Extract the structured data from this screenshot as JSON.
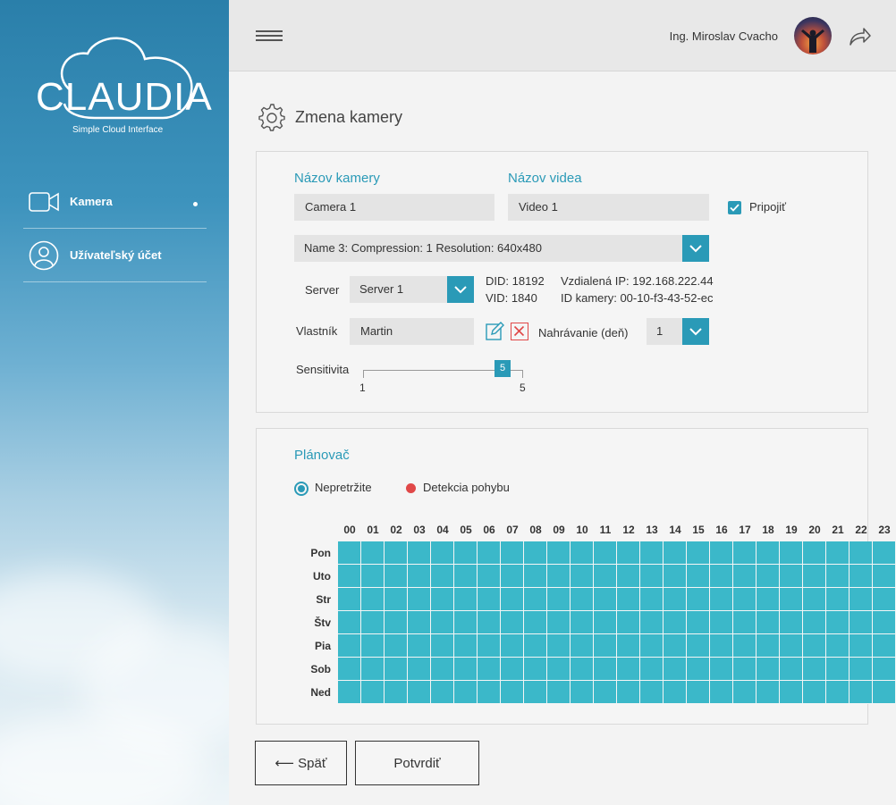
{
  "brand": {
    "logo_text": "CLAUDIA",
    "tagline": "Simple Cloud Interface"
  },
  "sidebar": {
    "items": [
      {
        "label": "Kamera",
        "icon": "video-camera-icon",
        "active": true
      },
      {
        "label": "Užívateľský účet",
        "icon": "user-icon",
        "active": false
      }
    ]
  },
  "header": {
    "user_name": "Ing. Miroslav Cvacho"
  },
  "page": {
    "title": "Zmena kamery"
  },
  "form": {
    "camera_name_label": "Názov kamery",
    "camera_name_value": "Camera 1",
    "video_name_label": "Názov videa",
    "video_name_value": "Video 1",
    "connect_label": "Pripojiť",
    "connect_checked": true,
    "stream_select": "Name 3: Compression: 1 Resolution: 640x480",
    "server_label": "Server",
    "server_value": "Server 1",
    "did": "DID: 18192",
    "vid": "VID: 1840",
    "remote_ip": "Vzdialená IP: 192.168.222.44",
    "camera_id": "ID kamery: 00-10-f3-43-52-ec",
    "owner_label": "Vlastník",
    "owner_value": "Martin",
    "recording_label": "Nahrávanie (deň)",
    "recording_value": "1",
    "sensitivity_label": "Sensitivita",
    "sensitivity_value": "5",
    "sensitivity_min": "1",
    "sensitivity_max": "5"
  },
  "scheduler": {
    "title": "Plánovač",
    "legend": [
      {
        "label": "Nepretržite",
        "color": "#2a9ab7",
        "selected": true
      },
      {
        "label": "Detekcia pohybu",
        "color": "#e04848",
        "selected": false
      }
    ],
    "hours": [
      "00",
      "01",
      "02",
      "03",
      "04",
      "05",
      "06",
      "07",
      "08",
      "09",
      "10",
      "11",
      "12",
      "13",
      "14",
      "15",
      "16",
      "17",
      "18",
      "19",
      "20",
      "21",
      "22",
      "23"
    ],
    "days": [
      "Pon",
      "Uto",
      "Str",
      "Štv",
      "Pia",
      "Sob",
      "Ned"
    ],
    "cell_color": "#3bb8c9"
  },
  "buttons": {
    "back": "⟵ Späť",
    "confirm": "Potvrdiť"
  },
  "colors": {
    "accent": "#2a9ab7",
    "danger": "#e04848"
  }
}
